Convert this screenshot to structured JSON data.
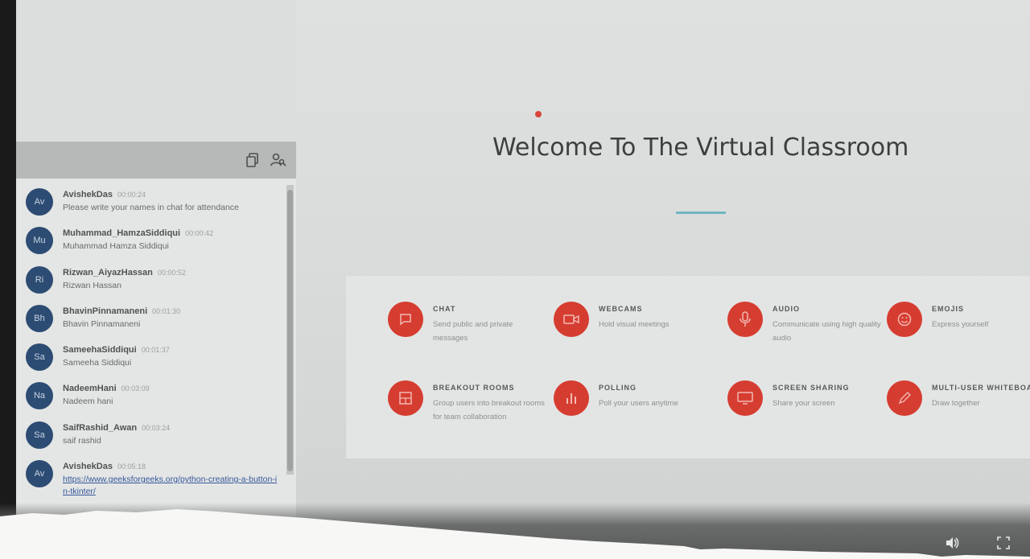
{
  "welcome_title": "Welcome To The Virtual Classroom",
  "accent_color": "#d63d31",
  "chat": {
    "header_icons": [
      "copy-icon",
      "users-search-icon"
    ],
    "messages": [
      {
        "initials": "Av",
        "name": "AvishekDas",
        "time": "00:00:24",
        "text": "Please write your names in chat for attendance"
      },
      {
        "initials": "Mu",
        "name": "Muhammad_HamzaSiddiqui",
        "time": "00:00:42",
        "text": "Muhammad Hamza Siddiqui"
      },
      {
        "initials": "Ri",
        "name": "Rizwan_AiyazHassan",
        "time": "00:00:52",
        "text": "Rizwan Hassan"
      },
      {
        "initials": "Bh",
        "name": "BhavinPinnamaneni",
        "time": "00:01:30",
        "text": "Bhavin Pinnamaneni"
      },
      {
        "initials": "Sa",
        "name": "SameehaSiddiqui",
        "time": "00:01:37",
        "text": "Sameeha Siddiqui"
      },
      {
        "initials": "Na",
        "name": "NadeemHani",
        "time": "00:03:09",
        "text": "Nadeem hani"
      },
      {
        "initials": "Sa",
        "name": "SaifRashid_Awan",
        "time": "00:03:24",
        "text": "saif rashid"
      },
      {
        "initials": "Av",
        "name": "AvishekDas",
        "time": "00:05:18",
        "text": "https://www.geeksforgeeks.org/python-creating-a-button-in-tkinter/"
      }
    ]
  },
  "features": [
    {
      "title": "CHAT",
      "desc": "Send public and private messages",
      "icon": "chat-icon"
    },
    {
      "title": "WEBCAMS",
      "desc": "Hold visual meetings",
      "icon": "webcam-icon"
    },
    {
      "title": "AUDIO",
      "desc": "Communicate using high quality audio",
      "icon": "microphone-icon"
    },
    {
      "title": "EMOJIS",
      "desc": "Express yourself",
      "icon": "emoji-icon"
    },
    {
      "title": "BREAKOUT ROOMS",
      "desc": "Group users into breakout rooms for team collaboration",
      "icon": "breakout-rooms-icon"
    },
    {
      "title": "POLLING",
      "desc": "Poll your users anytime",
      "icon": "polling-icon"
    },
    {
      "title": "SCREEN SHARING",
      "desc": "Share your screen",
      "icon": "screen-share-icon"
    },
    {
      "title": "MULTI-USER WHITEBOARD",
      "desc": "Draw together",
      "icon": "whiteboard-icon"
    }
  ],
  "controls": [
    "volume-icon",
    "fullscreen-icon"
  ]
}
